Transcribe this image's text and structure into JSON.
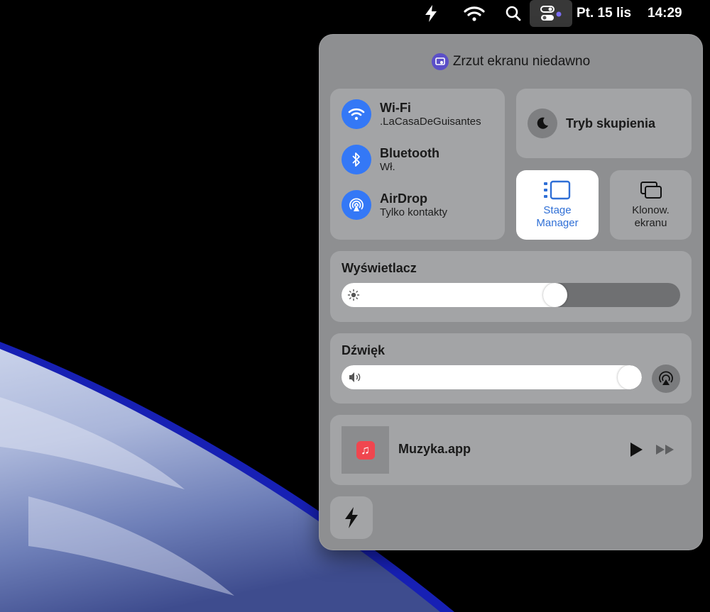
{
  "menubar": {
    "date": "Pt. 15 lis",
    "time": "14:29",
    "icons": [
      "bolt-icon",
      "wifi-icon",
      "search-icon",
      "control-center-icon"
    ]
  },
  "control_center": {
    "notice": "Zrzut ekranu niedawno",
    "wifi": {
      "title": "Wi-Fi",
      "subtitle": ".LaCasaDeGuisantes"
    },
    "bluetooth": {
      "title": "Bluetooth",
      "subtitle": "Wł."
    },
    "airdrop": {
      "title": "AirDrop",
      "subtitle": "Tylko kontakty"
    },
    "focus": {
      "label": "Tryb skupienia"
    },
    "stage_manager": {
      "label": "Stage Manager",
      "active": true
    },
    "screen_mirroring": {
      "label": "Klonow. ekranu"
    },
    "display": {
      "title": "Wyświetlacz",
      "brightness_percent": 64
    },
    "sound": {
      "title": "Dźwięk",
      "volume_percent": 100
    },
    "now_playing": {
      "app": "Muzyka.app"
    }
  },
  "colors": {
    "accent": "#3478f6",
    "panel": "#8e8f91",
    "tile": "#a3a4a6",
    "music_icon": "#f0464f"
  }
}
